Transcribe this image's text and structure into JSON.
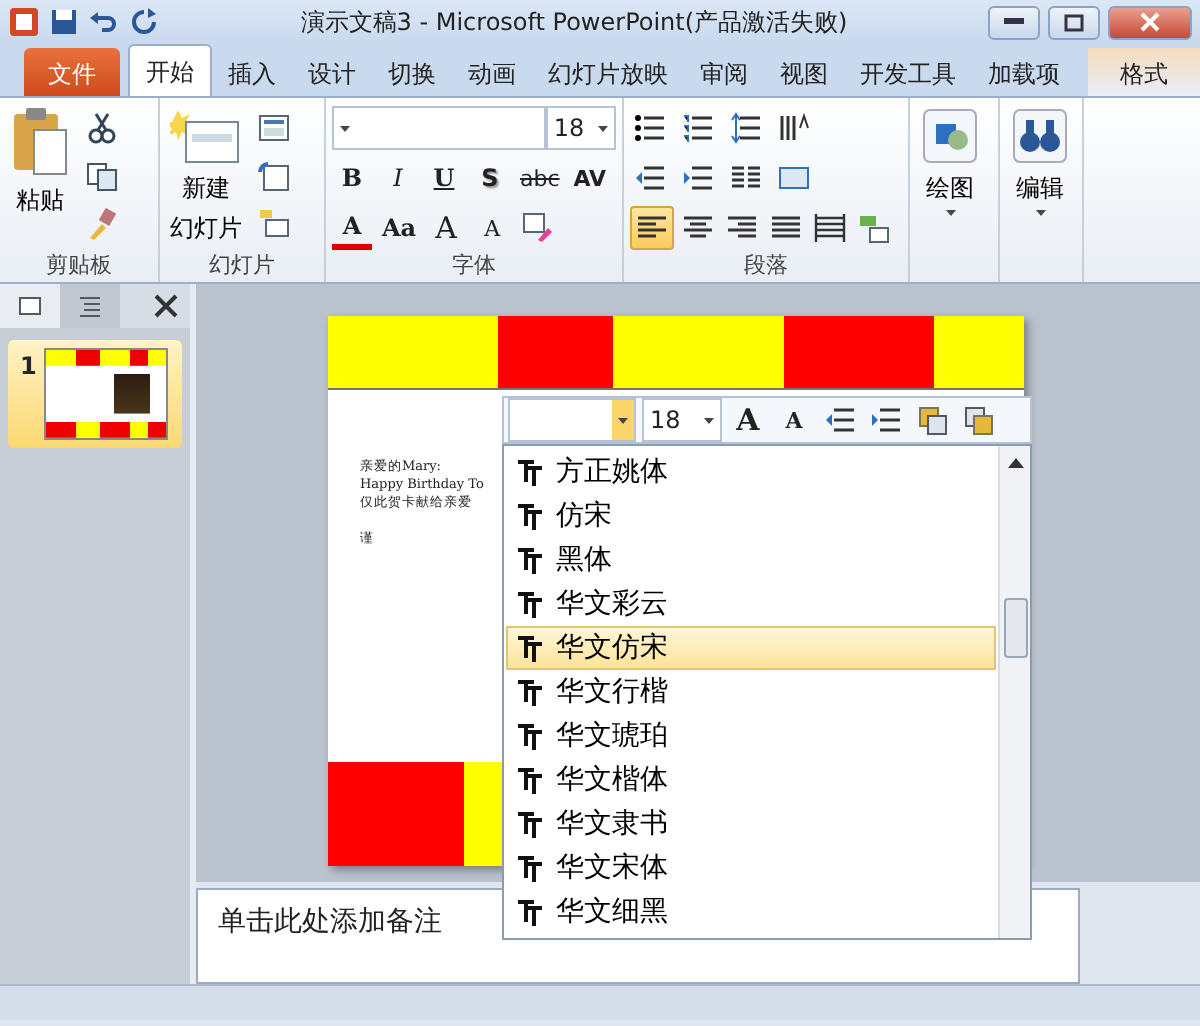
{
  "title_bar": {
    "title": "演示文稿3  -  Microsoft PowerPoint(产品激活失败)"
  },
  "tabs": [
    {
      "label": "文件",
      "kind": "file",
      "selected": false
    },
    {
      "label": "开始",
      "kind": "tab",
      "selected": true
    },
    {
      "label": "插入",
      "kind": "tab",
      "selected": false
    },
    {
      "label": "设计",
      "kind": "tab",
      "selected": false
    },
    {
      "label": "切换",
      "kind": "tab",
      "selected": false
    },
    {
      "label": "动画",
      "kind": "tab",
      "selected": false
    },
    {
      "label": "幻灯片放映",
      "kind": "tab",
      "selected": false
    },
    {
      "label": "审阅",
      "kind": "tab",
      "selected": false
    },
    {
      "label": "视图",
      "kind": "tab",
      "selected": false
    },
    {
      "label": "开发工具",
      "kind": "tab",
      "selected": false
    },
    {
      "label": "加载项",
      "kind": "tab",
      "selected": false
    },
    {
      "label": "格式",
      "kind": "contextual",
      "selected": false
    }
  ],
  "ribbon": {
    "clipboard": {
      "label": "剪贴板",
      "paste": "粘贴"
    },
    "slides": {
      "label": "幻灯片",
      "new_slide": [
        "新建",
        "幻灯片"
      ]
    },
    "font": {
      "label": "字体",
      "size": "18",
      "buttons": [
        "B",
        "I",
        "U",
        "S",
        "abc",
        "AV",
        "A",
        "Aa",
        "A",
        "A"
      ]
    },
    "paragraph": {
      "label": "段落",
      "alignments": [
        {
          "selected": true
        },
        {
          "selected": false
        },
        {
          "selected": false
        },
        {
          "selected": false
        },
        {
          "selected": false
        }
      ]
    },
    "drawing": {
      "label": "绘图"
    },
    "editing": {
      "label": "编辑"
    }
  },
  "slide_pane": {
    "tabs": [
      {
        "selected": true
      },
      {
        "selected": false
      }
    ],
    "slides": [
      {
        "number": "1",
        "selected": true
      }
    ]
  },
  "slide": {
    "lines": [
      "亲爱的Mary:",
      "Happy Birthday To",
      "仅此贺卡献给亲爱"
    ],
    "signature": "谨"
  },
  "mini_toolbar": {
    "size": "18",
    "grow": "A",
    "shrink": "A"
  },
  "font_list": {
    "items": [
      {
        "name": "方正姚体",
        "selected": false
      },
      {
        "name": "仿宋",
        "selected": false
      },
      {
        "name": "黑体",
        "selected": false
      },
      {
        "name": "华文彩云",
        "selected": false
      },
      {
        "name": "华文仿宋",
        "selected": true
      },
      {
        "name": "华文行楷",
        "selected": false
      },
      {
        "name": "华文琥珀",
        "selected": false
      },
      {
        "name": "华文楷体",
        "selected": false
      },
      {
        "name": "华文隶书",
        "selected": false
      },
      {
        "name": "华文宋体",
        "selected": false
      },
      {
        "name": "华文细黑",
        "selected": false
      }
    ]
  },
  "notes": {
    "placeholder": "单击此处添加备注"
  }
}
